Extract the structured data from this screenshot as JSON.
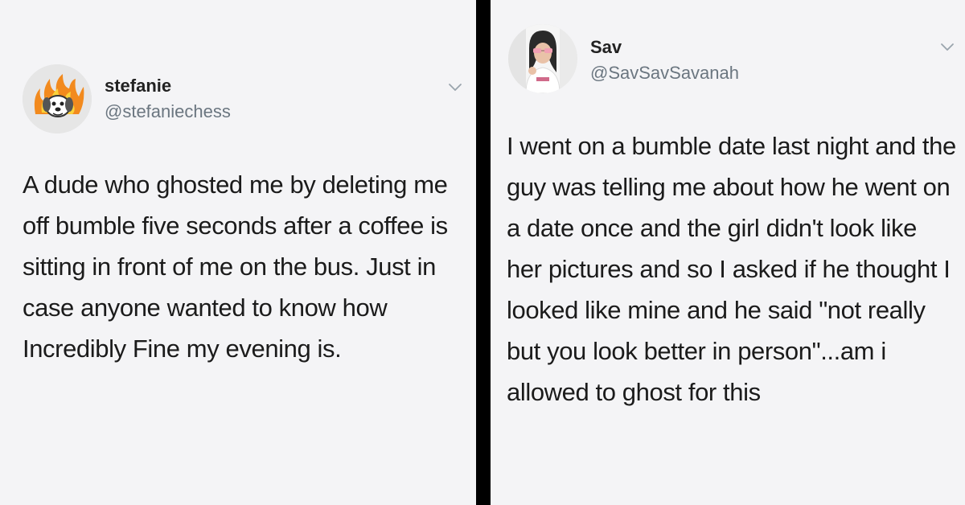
{
  "tweets": [
    {
      "display_name": "stefanie",
      "handle": "@stefaniechess",
      "avatar_icon": "dog-on-fire-avatar",
      "menu_icon": "chevron-down-icon",
      "text": "A dude who ghosted me by deleting me off bumble five seconds after a coffee is sitting in front of me on the bus. Just in case anyone wanted to know how Incredibly Fine my evening is."
    },
    {
      "display_name": "Sav",
      "handle": "@SavSavSavanah",
      "avatar_icon": "profile-photo-avatar",
      "menu_icon": "chevron-down-icon",
      "text": "I went on a bumble date last night and the guy was telling me about how he went on a date once and the girl didn't look like her pictures and so I asked if he thought I looked like mine and he said \"not really but you look better in person\"...am i allowed to ghost for this"
    }
  ],
  "colors": {
    "divider": "#000000",
    "panel_background": "#f4f4f6",
    "name_text": "#222222",
    "handle_text": "#6b7680",
    "tweet_text": "#1b1b1b"
  }
}
